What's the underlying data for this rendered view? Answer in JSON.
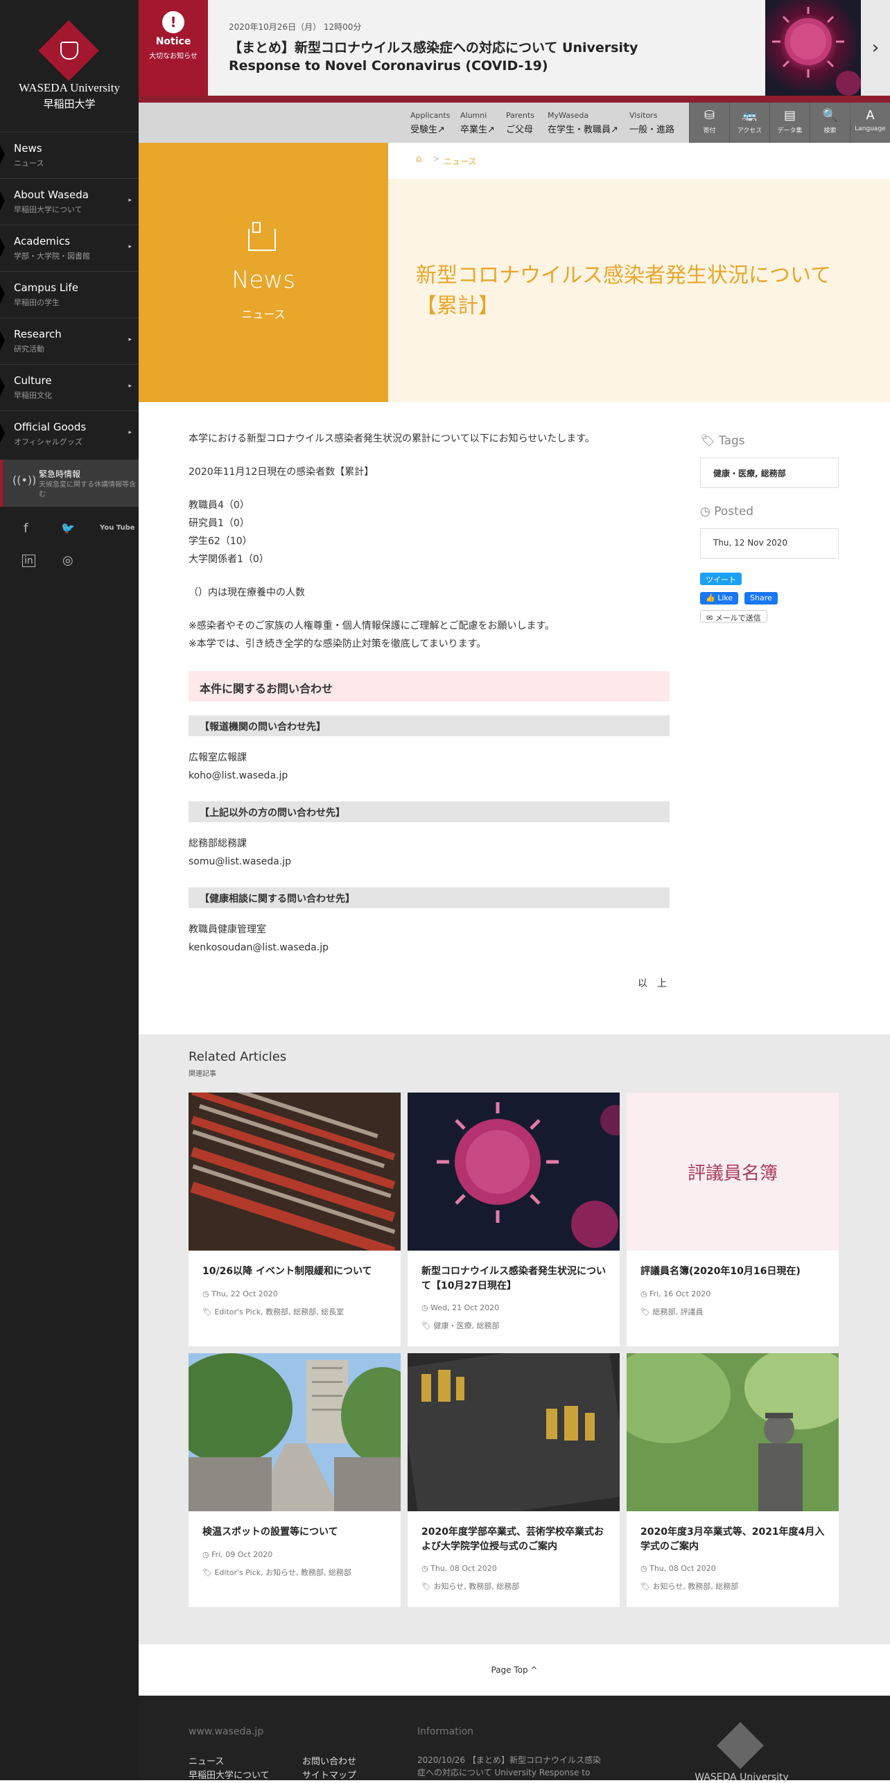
{
  "sidebar": {
    "logo_en": "WASEDA University",
    "logo_ja": "早稲田大学",
    "items": [
      {
        "en": "News",
        "ja": "ニュース",
        "arrow": ""
      },
      {
        "en": "About Waseda",
        "ja": "早稲田大学について",
        "arrow": "▸"
      },
      {
        "en": "Academics",
        "ja": "学部・大学院・図書館",
        "arrow": "▸"
      },
      {
        "en": "Campus Life",
        "ja": "早稲田の学生",
        "arrow": ""
      },
      {
        "en": "Research",
        "ja": "研究活動",
        "arrow": "▸"
      },
      {
        "en": "Culture",
        "ja": "早稲田文化",
        "arrow": "▸"
      },
      {
        "en": "Official Goods",
        "ja": "オフィシャルグッズ",
        "arrow": "▸"
      }
    ],
    "emergency_title": "緊急時情報",
    "emergency_sub": "天候急変に関する休講情報等含む",
    "emergency_icon": "((•))",
    "social": {
      "facebook": "f",
      "twitter": "🐦",
      "youtube": "You Tube",
      "linkedin": "in",
      "instagram": "◎"
    }
  },
  "notice": {
    "label": "Notice",
    "sub": "大切なお知らせ",
    "date": "2020年10月26日（月） 12時00分",
    "title": "【まとめ】新型コロナウイルス感染症への対応について University Response to Novel Coronavirus (COVID-19)",
    "next_icon": "›",
    "alert_glyph": "!"
  },
  "topnav": {
    "links": [
      {
        "en": "Applicants",
        "ja": "受験生↗"
      },
      {
        "en": "Alumni",
        "ja": "卒業生↗"
      },
      {
        "en": "Parents",
        "ja": "ご父母"
      },
      {
        "en": "MyWaseda",
        "ja": "在学生・教職員↗"
      },
      {
        "en": "Visitors",
        "ja": "一般・進路"
      }
    ],
    "tools": [
      {
        "label": "寄付",
        "glyph": "⛁"
      },
      {
        "label": "アクセス",
        "glyph": "🚌"
      },
      {
        "label": "データ集",
        "glyph": "▤"
      },
      {
        "label": "検索",
        "glyph": "🔍"
      },
      {
        "label": "Language",
        "glyph": "A"
      }
    ]
  },
  "hero": {
    "category_en": "News",
    "category_ja": "ニュース",
    "breadcrumb_home": "⌂",
    "breadcrumb_sep": ">",
    "breadcrumb_current": "ニュース",
    "title": "新型コロナウイルス感染者発生状況について【累計】"
  },
  "article": {
    "intro": "本学における新型コロナウイルス感染者発生状況の累計について以下にお知らせいたします。",
    "date_line": "2020年11月12日現在の感染者数【累計】",
    "counts": [
      "教職員4（0）",
      "研究員1（0）",
      "学生62（10）",
      "大学関係者1（0）"
    ],
    "note": "（）内は現在療養中の人数",
    "remarks": [
      "※感染者やそのご家族の人権尊重・個人情報保護にご理解とご配慮をお願いします。",
      "※本学では、引き続き全学的な感染防止対策を徹底してまいります。"
    ],
    "contact_heading": "本件に関するお問い合わせ",
    "contacts": [
      {
        "heading": "【報道機関の問い合わせ先】",
        "dept": "広報室広報課",
        "email": "koho@list.waseda.jp"
      },
      {
        "heading": "【上記以外の方の問い合わせ先】",
        "dept": "総務部総務課",
        "email": "somu@list.waseda.jp"
      },
      {
        "heading": "【健康相談に関する問い合わせ先】",
        "dept": "教職員健康管理室",
        "email": "kenkosoudan@list.waseda.jp"
      }
    ],
    "end": "以　上"
  },
  "aside": {
    "tags_label": "Tags",
    "tags": "健康・医療, 総務部",
    "posted_label": "Posted",
    "posted": "Thu, 12 Nov 2020",
    "tweet": "ツイート",
    "like": "Like",
    "share": "Share",
    "mail": "メールで送信"
  },
  "related": {
    "title": "Related Articles",
    "sub": "関連記事",
    "cards": [
      {
        "title": "10/26以降 イベント制限緩和について",
        "date": "Thu, 22 Oct 2020",
        "tags": "Editor's Pick, 教務部, 総務部, 総長室"
      },
      {
        "title": "新型コロナウイルス感染者発生状況について【10月27日現在】",
        "date": "Wed, 21 Oct 2020",
        "tags": "健康・医療, 総務部"
      },
      {
        "title": "評議員名簿(2020年10月16日現在)",
        "date": "Fri, 16 Oct 2020",
        "tags": "総務部, 評議員",
        "image_text": "評議員名簿"
      },
      {
        "title": "検温スポットの設置等について",
        "date": "Fri, 09 Oct 2020",
        "tags": "Editor's Pick, お知らせ, 教務部, 総務部"
      },
      {
        "title": "2020年度学部卒業式、芸術学校卒業式および大学院学位授与式のご案内",
        "date": "Thu, 08 Oct 2020",
        "tags": "お知らせ, 教務部, 総務部"
      },
      {
        "title": "2020年度3月卒業式等、2021年度4月入学式のご案内",
        "date": "Thu, 08 Oct 2020",
        "tags": "お知らせ, 教務部, 総務部"
      }
    ]
  },
  "pagetop": "Page Top ^",
  "footer": {
    "col1_heading": "www.waseda.jp",
    "col1_links": [
      "ニュース",
      "早稲田大学について"
    ],
    "col2_links": [
      "お問い合わせ",
      "サイトマップ"
    ],
    "info_heading": "Information",
    "info_text": "2020/10/26 【まとめ】新型コロナウイルス感染症への対応について University Response to",
    "logo_text": "WASEDA University"
  },
  "colors": {
    "brand": "#a3172f",
    "accent": "#e8a62b"
  }
}
